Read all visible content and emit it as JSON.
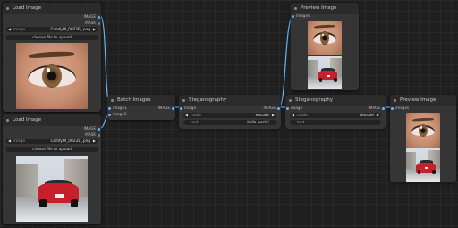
{
  "colors": {
    "canvas": "#1f1f1f",
    "node": "#353535",
    "header": "#2b2b2b",
    "link": "#64b5f6"
  },
  "nodes": {
    "load1": {
      "title": "Load Image",
      "outputs": [
        "IMAGE",
        "MASK"
      ],
      "image_widget": {
        "label": "image",
        "value": "ComfyUI_00230_.png"
      },
      "upload_label": "choose file to upload"
    },
    "load2": {
      "title": "Load Image",
      "outputs": [
        "IMAGE",
        "MASK"
      ],
      "image_widget": {
        "label": "image",
        "value": "ComfyUI_00235_.png"
      },
      "upload_label": "choose file to upload"
    },
    "batch": {
      "title": "Batch Images",
      "inputs": [
        "image1",
        "image2"
      ],
      "outputs": [
        "IMAGE"
      ]
    },
    "steg1": {
      "title": "Steganography",
      "inputs": [
        "image"
      ],
      "outputs": [
        "IMAGE"
      ],
      "mode": {
        "label": "mode",
        "value": "encode"
      },
      "text": {
        "label": "text",
        "value": "hello world!"
      }
    },
    "steg2": {
      "title": "Steganography",
      "inputs": [
        "image"
      ],
      "outputs": [
        "IMAGE"
      ],
      "mode": {
        "label": "mode",
        "value": "decode"
      },
      "text": {
        "label": "text",
        "value": ""
      }
    },
    "preview1": {
      "title": "Preview Image",
      "inputs": [
        "images"
      ]
    },
    "preview2": {
      "title": "Preview Image",
      "inputs": [
        "images"
      ]
    }
  }
}
